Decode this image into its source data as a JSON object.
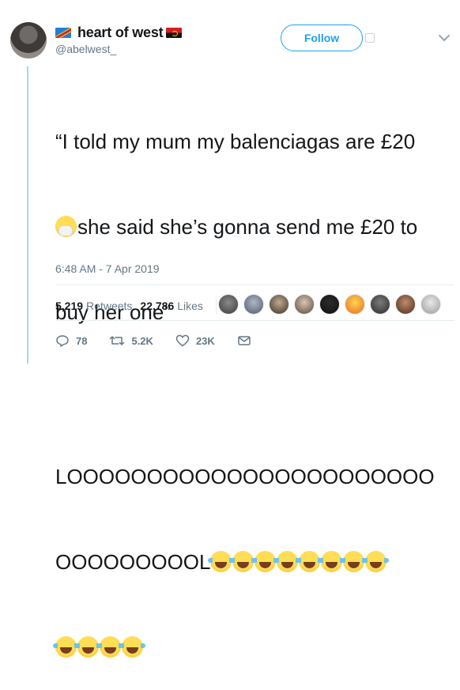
{
  "user": {
    "display_name": "heart of west",
    "handle": "@abelwest_",
    "flag_left": "drc-flag",
    "flag_right": "angola-flag"
  },
  "follow_button": {
    "label": "Follow"
  },
  "tweet": {
    "line1": "“I told my mum my balenciagas are £20",
    "line2": "she said she’s gonna send me £20 to",
    "line3": "buy her one”",
    "line4": "LOOOOOOOOOOOOOOOOOOOOOOO",
    "line5": "OOOOOOOOOL",
    "emoji_sneeze": "sneezing-face",
    "emoji_laugh": "face-with-tears-of-joy",
    "laugh_emoji_count": 12
  },
  "timestamp": "6:48 AM - 7 Apr 2019",
  "stats": {
    "retweets_count": "5,219",
    "retweets_label": "Retweets",
    "likes_count": "22,786",
    "likes_label": "Likes"
  },
  "actions": {
    "replies": "78",
    "retweets": "5.2K",
    "likes": "23K"
  },
  "colors": {
    "accent": "#1da1f2",
    "secondary_text": "#657786",
    "thread_line": "#a3d8f0",
    "divider": "#e6ecf0"
  }
}
